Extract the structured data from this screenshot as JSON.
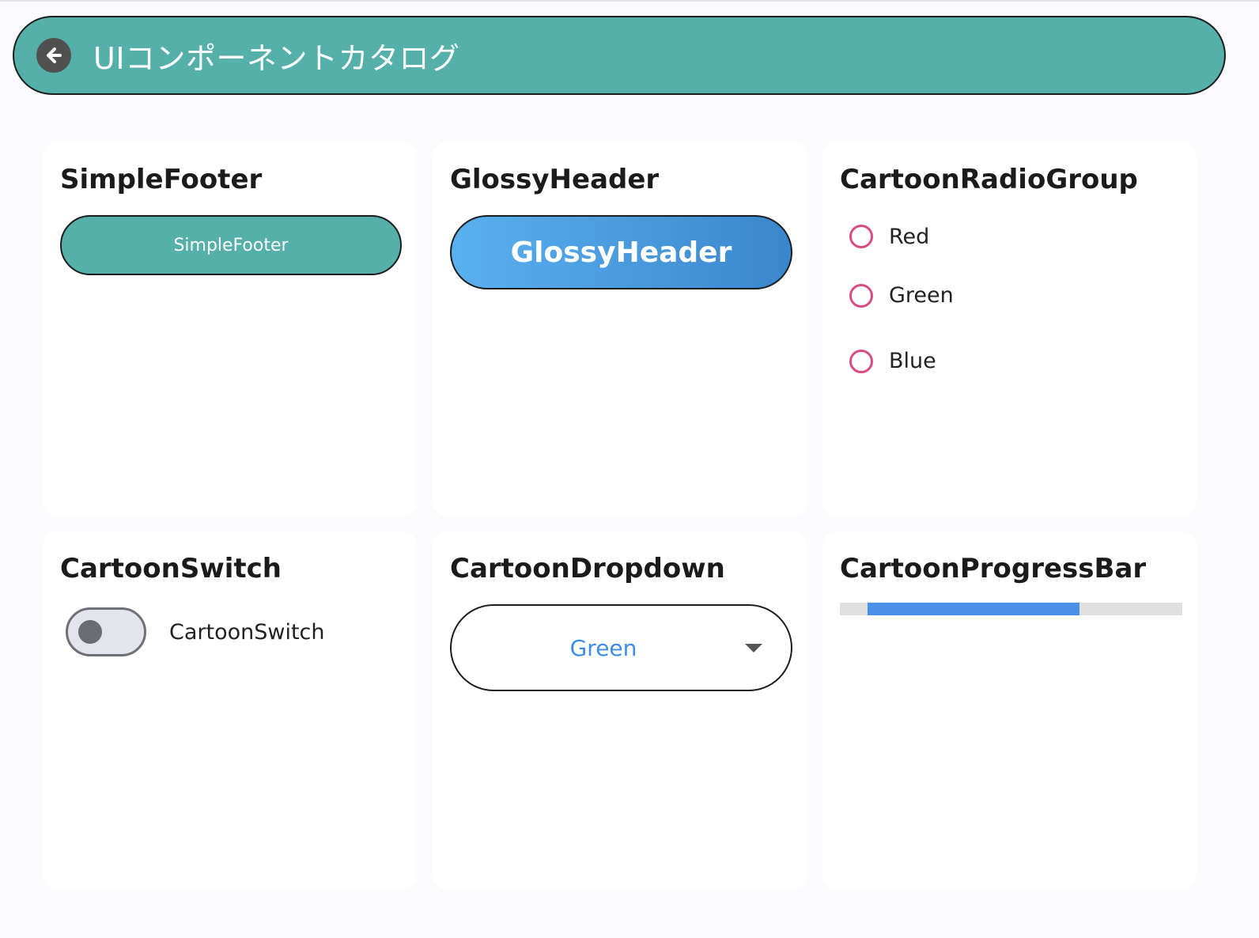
{
  "app_bar": {
    "title": "UIコンポーネントカタログ",
    "back_icon": "arrow-left-icon",
    "color": "#55b0a9"
  },
  "cards": {
    "simple_footer": {
      "title": "SimpleFooter",
      "button_label": "SimpleFooter"
    },
    "glossy_header": {
      "title": "GlossyHeader",
      "button_label": "GlossyHeader"
    },
    "radio_group": {
      "title": "CartoonRadioGroup",
      "options": [
        "Red",
        "Green",
        "Blue"
      ],
      "selected": null,
      "accent": "#d94c82"
    },
    "switch": {
      "title": "CartoonSwitch",
      "label": "CartoonSwitch",
      "on": false
    },
    "dropdown": {
      "title": "CartoonDropdown",
      "selected_value": "Green",
      "value_color": "#3f8ee5"
    },
    "progress": {
      "title": "CartoonProgressBar",
      "fill_color": "#4a90e8",
      "track_color": "#e0e0e0",
      "fill_start": 0.08,
      "fill_end": 0.7
    }
  }
}
